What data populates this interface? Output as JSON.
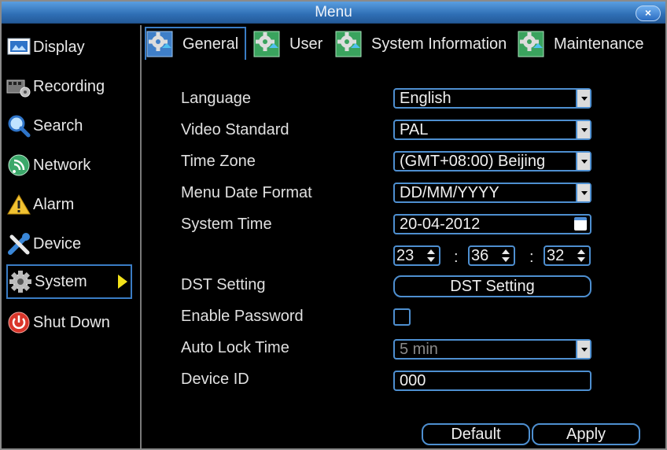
{
  "window": {
    "title": "Menu",
    "close_label": "×"
  },
  "sidebar": {
    "items": [
      {
        "label": "Display",
        "icon": "display-icon"
      },
      {
        "label": "Recording",
        "icon": "recording-icon"
      },
      {
        "label": "Search",
        "icon": "search-icon"
      },
      {
        "label": "Network",
        "icon": "network-icon"
      },
      {
        "label": "Alarm",
        "icon": "alarm-icon"
      },
      {
        "label": "Device",
        "icon": "device-icon"
      },
      {
        "label": "System",
        "icon": "system-gear-icon",
        "active": true
      },
      {
        "label": "Shut Down",
        "icon": "power-icon"
      }
    ]
  },
  "tabs": [
    {
      "label": "General",
      "active": true
    },
    {
      "label": "User"
    },
    {
      "label": "System Information"
    },
    {
      "label": "Maintenance"
    }
  ],
  "form": {
    "language": {
      "label": "Language",
      "value": "English"
    },
    "video_standard": {
      "label": "Video Standard",
      "value": "PAL"
    },
    "time_zone": {
      "label": "Time Zone",
      "value": "(GMT+08:00) Beijing"
    },
    "date_format": {
      "label": "Menu Date Format",
      "value": "DD/MM/YYYY"
    },
    "system_time": {
      "label": "System Time",
      "date": "20-04-2012",
      "hour": "23",
      "minute": "36",
      "second": "32",
      "separator": ":"
    },
    "dst": {
      "label": "DST Setting",
      "button": "DST Setting"
    },
    "enable_password": {
      "label": "Enable Password",
      "checked": false
    },
    "auto_lock": {
      "label": "Auto Lock Time",
      "value": "5 min"
    },
    "device_id": {
      "label": "Device ID",
      "value": "000"
    }
  },
  "footer": {
    "default_label": "Default",
    "apply_label": "Apply"
  },
  "colors": {
    "accent": "#4e8fd0",
    "titlebar": "#2f6fb5",
    "active_arrow": "#f3e21a"
  }
}
